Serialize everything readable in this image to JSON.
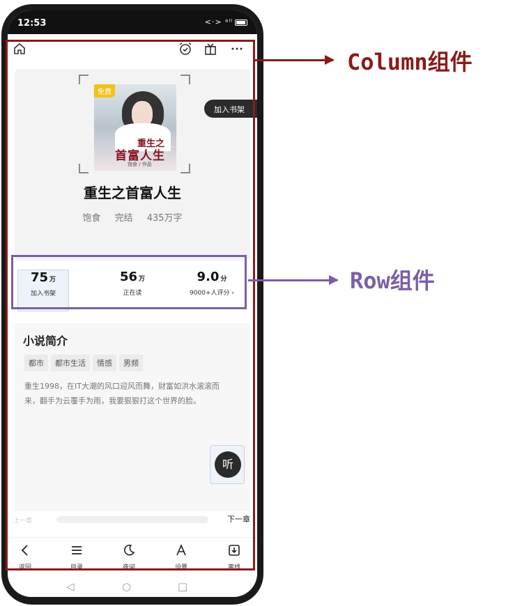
{
  "status_bar": {
    "time": "12:53",
    "signal": "<·> ᵃˡˡ"
  },
  "topbar": {
    "icons": [
      "home-icon",
      "alarm-icon",
      "gift-icon",
      "more-icon"
    ]
  },
  "book": {
    "cover_tag": "免费",
    "cover_title_line1": "重生之",
    "cover_title_line2": "首富人生",
    "cover_author_text": "饱食 / 作品",
    "title": "重生之首富人生",
    "author": "饱食",
    "status": "完结",
    "word_count": "435万字",
    "add_shelf_button": "加入书架"
  },
  "stats": [
    {
      "value": "75",
      "unit": "万",
      "label": "加入书架"
    },
    {
      "value": "56",
      "unit": "万",
      "label": "正在读"
    },
    {
      "value": "9.0",
      "unit": "分",
      "label": "9000+人评分 ›"
    }
  ],
  "intro": {
    "heading": "小说简介",
    "tags": [
      "都市",
      "都市生活",
      "情感",
      "男频"
    ],
    "description": "重生1998，在IT大潮的风口迎风而舞，财富如洪水滚滚而来，翻手为云覆手为雨，我要狠狠打这个世界的脸。"
  },
  "listen_button": "听",
  "chapters": {
    "prev": "上一章",
    "next": "下一章"
  },
  "bottom_nav": [
    {
      "icon": "back-icon",
      "label": "返回"
    },
    {
      "icon": "catalog-icon",
      "label": "目录"
    },
    {
      "icon": "night-icon",
      "label": "夜间"
    },
    {
      "icon": "font-settings-icon",
      "label": "设置"
    },
    {
      "icon": "download-icon",
      "label": "离线"
    }
  ],
  "annotations": {
    "column_label": "Column组件",
    "row_label": "Row组件",
    "column_color": "#8b1a1a",
    "row_color": "#7b5ea7"
  }
}
